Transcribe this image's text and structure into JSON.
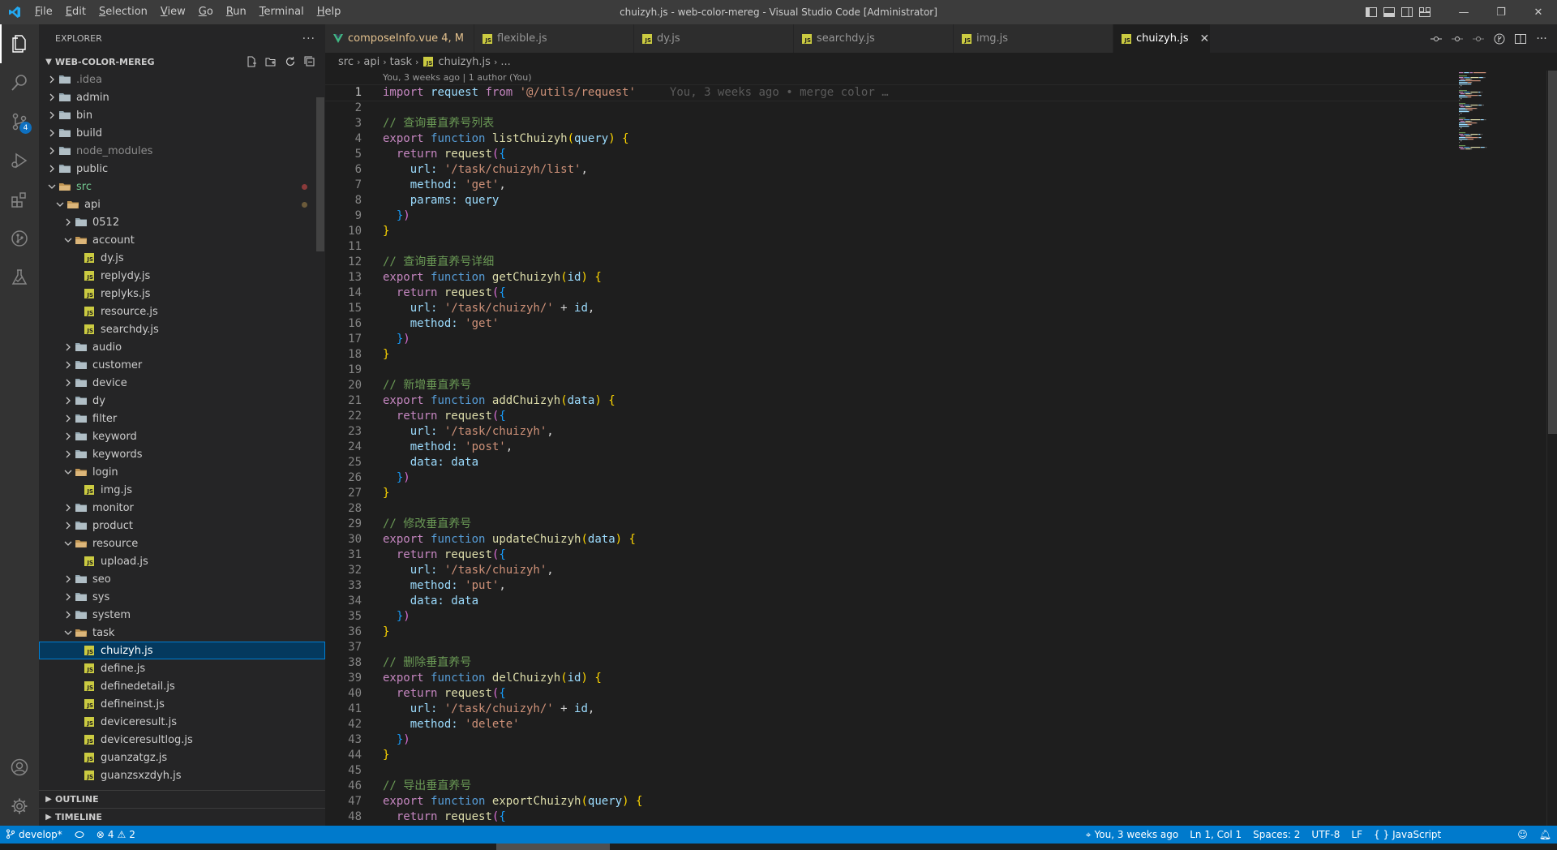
{
  "window": {
    "title": "chuizyh.js - web-color-mereg - Visual Studio Code [Administrator]",
    "menu": [
      {
        "label": "File"
      },
      {
        "label": "Edit"
      },
      {
        "label": "Selection"
      },
      {
        "label": "View"
      },
      {
        "label": "Go"
      },
      {
        "label": "Run"
      },
      {
        "label": "Terminal"
      },
      {
        "label": "Help"
      }
    ]
  },
  "activity_bar": {
    "scm_badge": "4"
  },
  "sidebar": {
    "header": "EXPLORER",
    "more": "···",
    "workspace": "WEB-COLOR-MEREG",
    "tree": [
      {
        "label": ".idea",
        "depth": 0,
        "kind": "folder",
        "open": false,
        "style": "dim"
      },
      {
        "label": "admin",
        "depth": 0,
        "kind": "folder",
        "open": false
      },
      {
        "label": "bin",
        "depth": 0,
        "kind": "folder",
        "open": false
      },
      {
        "label": "build",
        "depth": 0,
        "kind": "folder",
        "open": false
      },
      {
        "label": "node_modules",
        "depth": 0,
        "kind": "folder",
        "open": false,
        "style": "dim"
      },
      {
        "label": "public",
        "depth": 0,
        "kind": "folder",
        "open": false
      },
      {
        "label": "src",
        "depth": 0,
        "kind": "folder",
        "open": true,
        "style": "src",
        "dot": "red"
      },
      {
        "label": "api",
        "depth": 1,
        "kind": "folder",
        "open": true,
        "dot": "brown"
      },
      {
        "label": "0512",
        "depth": 2,
        "kind": "folder",
        "open": false
      },
      {
        "label": "account",
        "depth": 2,
        "kind": "folder",
        "open": true
      },
      {
        "label": "dy.js",
        "depth": 3,
        "kind": "js"
      },
      {
        "label": "replydy.js",
        "depth": 3,
        "kind": "js"
      },
      {
        "label": "replyks.js",
        "depth": 3,
        "kind": "js"
      },
      {
        "label": "resource.js",
        "depth": 3,
        "kind": "js"
      },
      {
        "label": "searchdy.js",
        "depth": 3,
        "kind": "js"
      },
      {
        "label": "audio",
        "depth": 2,
        "kind": "folder",
        "open": false
      },
      {
        "label": "customer",
        "depth": 2,
        "kind": "folder",
        "open": false
      },
      {
        "label": "device",
        "depth": 2,
        "kind": "folder",
        "open": false
      },
      {
        "label": "dy",
        "depth": 2,
        "kind": "folder",
        "open": false
      },
      {
        "label": "filter",
        "depth": 2,
        "kind": "folder",
        "open": false
      },
      {
        "label": "keyword",
        "depth": 2,
        "kind": "folder",
        "open": false
      },
      {
        "label": "keywords",
        "depth": 2,
        "kind": "folder",
        "open": false
      },
      {
        "label": "login",
        "depth": 2,
        "kind": "folder",
        "open": true
      },
      {
        "label": "img.js",
        "depth": 3,
        "kind": "js"
      },
      {
        "label": "monitor",
        "depth": 2,
        "kind": "folder",
        "open": false
      },
      {
        "label": "product",
        "depth": 2,
        "kind": "folder",
        "open": false
      },
      {
        "label": "resource",
        "depth": 2,
        "kind": "folder",
        "open": true
      },
      {
        "label": "upload.js",
        "depth": 3,
        "kind": "js"
      },
      {
        "label": "seo",
        "depth": 2,
        "kind": "folder",
        "open": false
      },
      {
        "label": "sys",
        "depth": 2,
        "kind": "folder",
        "open": false
      },
      {
        "label": "system",
        "depth": 2,
        "kind": "folder",
        "open": false
      },
      {
        "label": "task",
        "depth": 2,
        "kind": "folder",
        "open": true
      },
      {
        "label": "chuizyh.js",
        "depth": 3,
        "kind": "js",
        "selected": true
      },
      {
        "label": "define.js",
        "depth": 3,
        "kind": "js"
      },
      {
        "label": "definedetail.js",
        "depth": 3,
        "kind": "js"
      },
      {
        "label": "defineinst.js",
        "depth": 3,
        "kind": "js"
      },
      {
        "label": "deviceresult.js",
        "depth": 3,
        "kind": "js"
      },
      {
        "label": "deviceresultlog.js",
        "depth": 3,
        "kind": "js"
      },
      {
        "label": "guanzatgz.js",
        "depth": 3,
        "kind": "js"
      },
      {
        "label": "guanzsxzdyh.js",
        "depth": 3,
        "kind": "js"
      }
    ],
    "outline": "OUTLINE",
    "timeline": "TIMELINE"
  },
  "tabs": [
    {
      "label": "composeInfo.vue",
      "status": "4, M",
      "icon": "vue-icon",
      "active": false
    },
    {
      "label": "flexible.js",
      "icon": "js-icon",
      "active": false
    },
    {
      "label": "dy.js",
      "icon": "js-icon",
      "active": false
    },
    {
      "label": "searchdy.js",
      "icon": "js-icon",
      "active": false
    },
    {
      "label": "img.js",
      "icon": "js-icon",
      "active": false
    },
    {
      "label": "chuizyh.js",
      "icon": "js-icon",
      "active": true
    }
  ],
  "breadcrumb": [
    "src",
    "api",
    "task",
    "chuizyh.js",
    "..."
  ],
  "editor": {
    "codelens": "You, 3 weeks ago | 1 author (You)",
    "blame": "You, 3 weeks ago • merge color …",
    "lines": [
      [
        [
          "import",
          "kw"
        ],
        [
          " "
        ],
        [
          "request",
          "var"
        ],
        [
          " "
        ],
        [
          "from",
          "kw"
        ],
        [
          " "
        ],
        [
          "'@/utils/request'",
          "str"
        ]
      ],
      [],
      [
        [
          "// 查询垂直养号列表",
          "com"
        ]
      ],
      [
        [
          "export",
          "kw"
        ],
        [
          " "
        ],
        [
          "function",
          "st"
        ],
        [
          " "
        ],
        [
          "listChuizyh",
          "fn"
        ],
        [
          "(",
          "b1"
        ],
        [
          "query",
          "var"
        ],
        [
          ")",
          "b1"
        ],
        [
          " "
        ],
        [
          "{",
          "b1"
        ]
      ],
      [
        [
          "  "
        ],
        [
          "return",
          "kw"
        ],
        [
          " "
        ],
        [
          "request",
          "fn"
        ],
        [
          "(",
          "b2"
        ],
        [
          "{",
          "b3"
        ]
      ],
      [
        [
          "    url: ",
          "var"
        ],
        [
          "'/task/chuizyh/list'",
          "str"
        ],
        [
          ","
        ]
      ],
      [
        [
          "    method: ",
          "var"
        ],
        [
          "'get'",
          "str"
        ],
        [
          ","
        ]
      ],
      [
        [
          "    params: ",
          "var"
        ],
        [
          "query",
          "var"
        ]
      ],
      [
        [
          "  "
        ],
        [
          "}",
          "b3"
        ],
        [
          ")",
          "b2"
        ]
      ],
      [
        [
          "}",
          "b1"
        ]
      ],
      [],
      [
        [
          "// 查询垂直养号详细",
          "com"
        ]
      ],
      [
        [
          "export",
          "kw"
        ],
        [
          " "
        ],
        [
          "function",
          "st"
        ],
        [
          " "
        ],
        [
          "getChuizyh",
          "fn"
        ],
        [
          "(",
          "b1"
        ],
        [
          "id",
          "var"
        ],
        [
          ")",
          "b1"
        ],
        [
          " "
        ],
        [
          "{",
          "b1"
        ]
      ],
      [
        [
          "  "
        ],
        [
          "return",
          "kw"
        ],
        [
          " "
        ],
        [
          "request",
          "fn"
        ],
        [
          "(",
          "b2"
        ],
        [
          "{",
          "b3"
        ]
      ],
      [
        [
          "    url: ",
          "var"
        ],
        [
          "'/task/chuizyh/'",
          "str"
        ],
        [
          " + "
        ],
        [
          "id",
          "var"
        ],
        [
          ","
        ]
      ],
      [
        [
          "    method: ",
          "var"
        ],
        [
          "'get'",
          "str"
        ]
      ],
      [
        [
          "  "
        ],
        [
          "}",
          "b3"
        ],
        [
          ")",
          "b2"
        ]
      ],
      [
        [
          "}",
          "b1"
        ]
      ],
      [],
      [
        [
          "// 新增垂直养号",
          "com"
        ]
      ],
      [
        [
          "export",
          "kw"
        ],
        [
          " "
        ],
        [
          "function",
          "st"
        ],
        [
          " "
        ],
        [
          "addChuizyh",
          "fn"
        ],
        [
          "(",
          "b1"
        ],
        [
          "data",
          "var"
        ],
        [
          ")",
          "b1"
        ],
        [
          " "
        ],
        [
          "{",
          "b1"
        ]
      ],
      [
        [
          "  "
        ],
        [
          "return",
          "kw"
        ],
        [
          " "
        ],
        [
          "request",
          "fn"
        ],
        [
          "(",
          "b2"
        ],
        [
          "{",
          "b3"
        ]
      ],
      [
        [
          "    url: ",
          "var"
        ],
        [
          "'/task/chuizyh'",
          "str"
        ],
        [
          ","
        ]
      ],
      [
        [
          "    method: ",
          "var"
        ],
        [
          "'post'",
          "str"
        ],
        [
          ","
        ]
      ],
      [
        [
          "    data: ",
          "var"
        ],
        [
          "data",
          "var"
        ]
      ],
      [
        [
          "  "
        ],
        [
          "}",
          "b3"
        ],
        [
          ")",
          "b2"
        ]
      ],
      [
        [
          "}",
          "b1"
        ]
      ],
      [],
      [
        [
          "// 修改垂直养号",
          "com"
        ]
      ],
      [
        [
          "export",
          "kw"
        ],
        [
          " "
        ],
        [
          "function",
          "st"
        ],
        [
          " "
        ],
        [
          "updateChuizyh",
          "fn"
        ],
        [
          "(",
          "b1"
        ],
        [
          "data",
          "var"
        ],
        [
          ")",
          "b1"
        ],
        [
          " "
        ],
        [
          "{",
          "b1"
        ]
      ],
      [
        [
          "  "
        ],
        [
          "return",
          "kw"
        ],
        [
          " "
        ],
        [
          "request",
          "fn"
        ],
        [
          "(",
          "b2"
        ],
        [
          "{",
          "b3"
        ]
      ],
      [
        [
          "    url: ",
          "var"
        ],
        [
          "'/task/chuizyh'",
          "str"
        ],
        [
          ","
        ]
      ],
      [
        [
          "    method: ",
          "var"
        ],
        [
          "'put'",
          "str"
        ],
        [
          ","
        ]
      ],
      [
        [
          "    data: ",
          "var"
        ],
        [
          "data",
          "var"
        ]
      ],
      [
        [
          "  "
        ],
        [
          "}",
          "b3"
        ],
        [
          ")",
          "b2"
        ]
      ],
      [
        [
          "}",
          "b1"
        ]
      ],
      [],
      [
        [
          "// 删除垂直养号",
          "com"
        ]
      ],
      [
        [
          "export",
          "kw"
        ],
        [
          " "
        ],
        [
          "function",
          "st"
        ],
        [
          " "
        ],
        [
          "delChuizyh",
          "fn"
        ],
        [
          "(",
          "b1"
        ],
        [
          "id",
          "var"
        ],
        [
          ")",
          "b1"
        ],
        [
          " "
        ],
        [
          "{",
          "b1"
        ]
      ],
      [
        [
          "  "
        ],
        [
          "return",
          "kw"
        ],
        [
          " "
        ],
        [
          "request",
          "fn"
        ],
        [
          "(",
          "b2"
        ],
        [
          "{",
          "b3"
        ]
      ],
      [
        [
          "    url: ",
          "var"
        ],
        [
          "'/task/chuizyh/'",
          "str"
        ],
        [
          " + "
        ],
        [
          "id",
          "var"
        ],
        [
          ","
        ]
      ],
      [
        [
          "    method: ",
          "var"
        ],
        [
          "'delete'",
          "str"
        ]
      ],
      [
        [
          "  "
        ],
        [
          "}",
          "b3"
        ],
        [
          ")",
          "b2"
        ]
      ],
      [
        [
          "}",
          "b1"
        ]
      ],
      [],
      [
        [
          "// 导出垂直养号",
          "com"
        ]
      ],
      [
        [
          "export",
          "kw"
        ],
        [
          " "
        ],
        [
          "function",
          "st"
        ],
        [
          " "
        ],
        [
          "exportChuizyh",
          "fn"
        ],
        [
          "(",
          "b1"
        ],
        [
          "query",
          "var"
        ],
        [
          ")",
          "b1"
        ],
        [
          " "
        ],
        [
          "{",
          "b1"
        ]
      ],
      [
        [
          "  "
        ],
        [
          "return",
          "kw"
        ],
        [
          " "
        ],
        [
          "request",
          "fn"
        ],
        [
          "(",
          "b2"
        ],
        [
          "{",
          "b3"
        ]
      ]
    ]
  },
  "statusbar": {
    "branch": "develop*",
    "errors": "4",
    "warnings": "2",
    "blame": "You, 3 weeks ago",
    "position": "Ln 1, Col 1",
    "spaces": "Spaces: 2",
    "encoding": "UTF-8",
    "eol": "LF",
    "language": "JavaScript"
  },
  "colors": {
    "accent": "#007acc",
    "titlebar": "#3c3c3c",
    "activitybar": "#333333",
    "sidebar": "#252526",
    "editor": "#1e1e1e"
  }
}
